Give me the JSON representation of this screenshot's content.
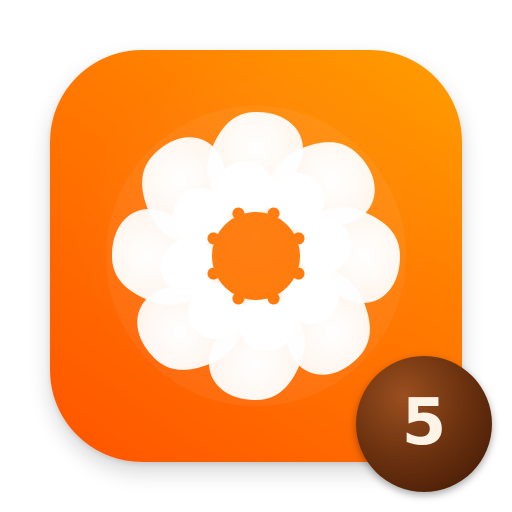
{
  "app_icon": {
    "icon": "aperture-swirl-icon",
    "colors": {
      "gradient_top": "#ff9f00",
      "gradient_bottom": "#ff5400",
      "petal": "#ffffff"
    }
  },
  "badge": {
    "count": "5",
    "colors": {
      "background": "#6e3310",
      "text": "#fdf3e6"
    }
  }
}
